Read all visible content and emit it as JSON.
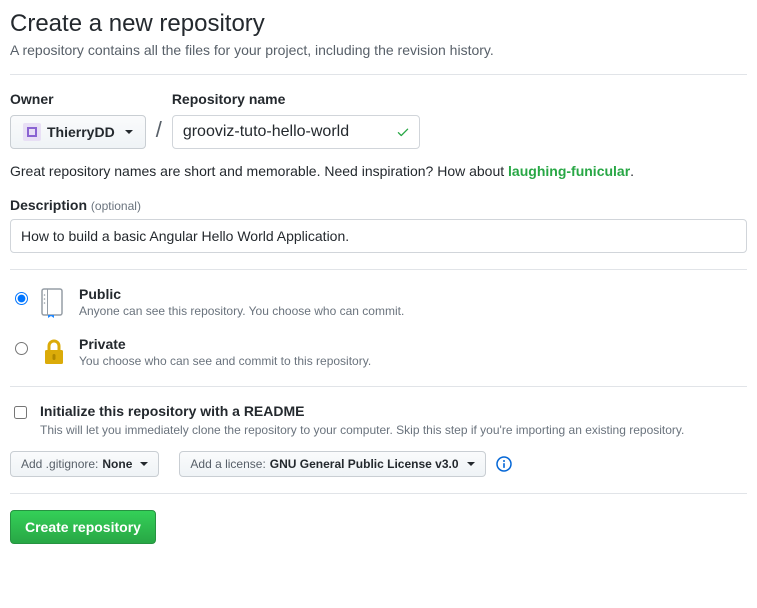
{
  "title": "Create a new repository",
  "subhead": "A repository contains all the files for your project, including the revision history.",
  "owner": {
    "label": "Owner",
    "selected": "ThierryDD"
  },
  "repoName": {
    "label": "Repository name",
    "value": "grooviz-tuto-hello-world"
  },
  "hint": {
    "prefix": "Great repository names are short and memorable. Need inspiration? How about ",
    "suggestion": "laughing-funicular",
    "suffix": "."
  },
  "description": {
    "label": "Description",
    "optional": "(optional)",
    "value": "How to build a basic Angular Hello World Application."
  },
  "visibility": {
    "public": {
      "label": "Public",
      "desc": "Anyone can see this repository. You choose who can commit."
    },
    "private": {
      "label": "Private",
      "desc": "You choose who can see and commit to this repository."
    }
  },
  "readme": {
    "label": "Initialize this repository with a README",
    "desc": "This will let you immediately clone the repository to your computer. Skip this step if you're importing an existing repository."
  },
  "gitignore": {
    "prefix": "Add .gitignore:",
    "selected": "None"
  },
  "license": {
    "prefix": "Add a license:",
    "selected": "GNU General Public License v3.0"
  },
  "submit": "Create repository"
}
